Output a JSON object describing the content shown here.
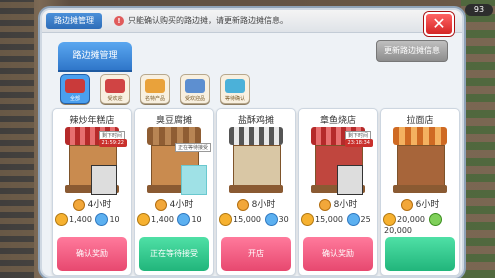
{
  "header": {
    "tab_label": "路边摊管理",
    "info_icon": "!",
    "notice": "只能确认购买的路边摊，请更新路边摊信息。",
    "close_label": "✕"
  },
  "background": {
    "score_text": "93"
  },
  "subtab": {
    "label": "路边摊管理"
  },
  "update_button": {
    "label": "更新路边摊信息"
  },
  "category_tabs": [
    {
      "label": "全部",
      "icon": "stall-icon"
    },
    {
      "label": "受欢迎",
      "icon": "shop-icon"
    },
    {
      "label": "名特产品",
      "icon": "food-icon"
    },
    {
      "label": "受欢迎品",
      "icon": "people-icon"
    },
    {
      "label": "等待确认",
      "icon": "book-icon"
    }
  ],
  "stalls": [
    {
      "name": "辣炒年糕店",
      "remain_label": "剩下时间",
      "time": "21:59:22",
      "duration": "4小时",
      "coin": "1,400",
      "exp": "10",
      "action": "确认奖励",
      "colors": {
        "button": "#e7486f"
      }
    },
    {
      "name": "臭豆腐摊",
      "wait_label": "正在等待接受",
      "duration": "4小时",
      "coin": "1,400",
      "exp": "10",
      "action": "正在等待接受",
      "colors": {
        "button": "#21b57b"
      }
    },
    {
      "name": "盐酥鸡摊",
      "duration": "8小时",
      "coin": "15,000",
      "exp": "30",
      "action": "开店",
      "colors": {
        "button": "#e7486f"
      }
    },
    {
      "name": "章鱼烧店",
      "remain_label": "剩下时间",
      "time": "23:18:34",
      "duration": "8小时",
      "coin": "15,000",
      "exp": "25",
      "action": "确认奖励",
      "colors": {
        "button": "#e7486f"
      }
    },
    {
      "name": "拉面店",
      "duration": "6小时",
      "coin": "20,000",
      "exp": "20,000",
      "action": "",
      "colors": {
        "button": "#21b57b"
      }
    }
  ]
}
